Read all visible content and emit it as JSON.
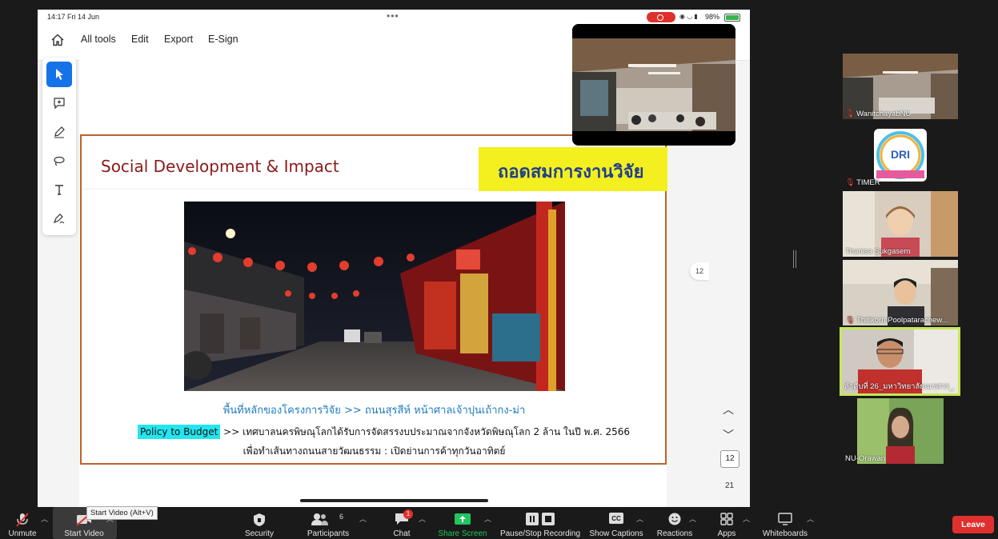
{
  "ipad_status": {
    "time_date": "14:17  Fri 14 Jun",
    "dots": "•••",
    "battery_pct": "98%",
    "battery_level": 0.98
  },
  "pdf_toolbar": {
    "items": [
      "All tools",
      "Edit",
      "Export",
      "E-Sign"
    ]
  },
  "slide": {
    "title": "Social Development & Impact",
    "banner": "ถอดสมการงานวิจัย",
    "caption": "พื้นที่หลักของโครงการวิจัย >> ถนนสุรสีห์ หน้าศาลเจ้าปุนเถ้ากง-ม่า",
    "policy_tag": "Policy to Budget",
    "policy_text": " >> เทศบาลนครพิษณุโลกได้รับการจัดสรรงบประมาณจากจังหวัดพิษณุโลก 2 ล้าน ในปี พ.ศ. 2566",
    "policy_text2": "เพื่อทำเส้นทางถนนสายวัฒนธรรม : เปิดย่านการค้าทุกวันอาทิตย์"
  },
  "page_nav": {
    "side_badge": "12",
    "current": "12",
    "total": "21"
  },
  "participants": [
    {
      "name": "WanitchayabNU",
      "muted": true
    },
    {
      "name": "TIMER",
      "muted": true
    },
    {
      "name": "Thanisa Sukgasem",
      "muted": false
    },
    {
      "name": "Thitikorn Poolpatarachew...",
      "muted": true
    },
    {
      "name": "ลำดับที่ 26_มหาวิทยาลัยนเรศวร_...",
      "muted": false,
      "speaking": true
    },
    {
      "name": "NU-Orawan",
      "muted": false
    }
  ],
  "controls": {
    "unmute": "Unmute",
    "start_video": "Start Video",
    "start_video_tooltip": "Start Video (Alt+V)",
    "security": "Security",
    "participants": "Participants",
    "participants_count": "6",
    "chat": "Chat",
    "chat_badge": "1",
    "share_screen": "Share Screen",
    "recording": "Pause/Stop Recording",
    "captions": "Show Captions",
    "reactions": "Reactions",
    "apps": "Apps",
    "whiteboards": "Whiteboards",
    "leave": "Leave"
  },
  "colors": {
    "accent_blue": "#1473e6",
    "leave_red": "#e0302d",
    "share_green": "#22c55e",
    "active_speaker": "#c8e65a",
    "slide_border": "#c0622b",
    "banner_yellow": "#f4ef1e"
  }
}
